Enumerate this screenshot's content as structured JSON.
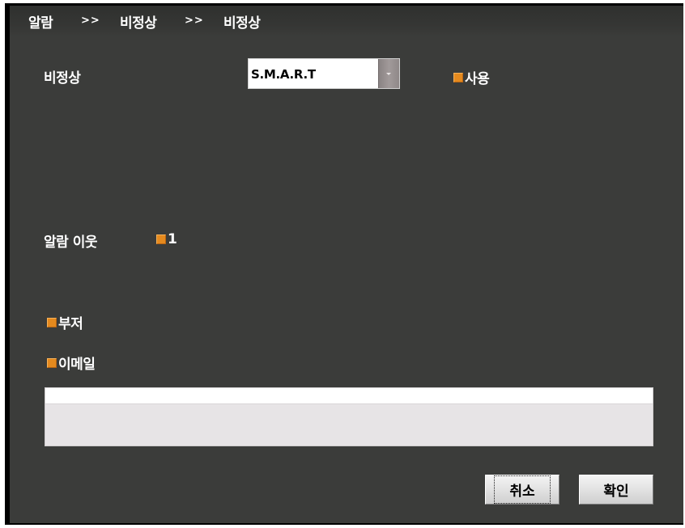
{
  "breadcrumb": {
    "items": [
      "알람",
      "비정상",
      "비정상"
    ],
    "separator": ">>"
  },
  "event": {
    "label": "비정상",
    "selected": "S.M.A.R.T",
    "enable_label": "사용"
  },
  "alarm_out": {
    "label": "알람 이웃",
    "channel_1": "1"
  },
  "buzzer": {
    "label": "부저"
  },
  "email": {
    "label": "이메일",
    "value": ""
  },
  "buttons": {
    "cancel": "취소",
    "ok": "확인"
  },
  "colors": {
    "panel_bg": "#3b3c3a",
    "checkbox": "#e58a1e",
    "text": "#ffffff"
  },
  "icons": {
    "dropdown": "chevron-down-icon"
  }
}
